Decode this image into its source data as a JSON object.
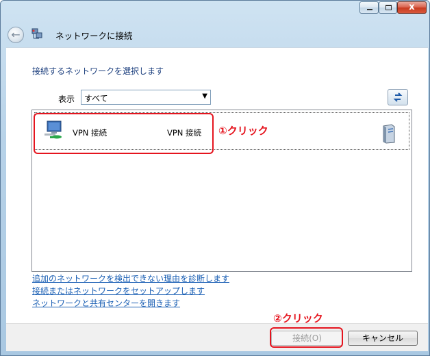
{
  "window": {
    "title": "ネットワークに接続",
    "close_glyph": "x"
  },
  "main": {
    "heading": "接続するネットワークを選択します",
    "show_label": "表示",
    "filter_selected": "すべて",
    "connections": [
      {
        "name": "VPN 接続",
        "type": "VPN 接続"
      }
    ]
  },
  "links": [
    "追加のネットワークを検出できない理由を診断します",
    "接続またはネットワークをセットアップします",
    "ネットワークと共有センターを開きます"
  ],
  "buttons": {
    "connect": "接続(O)",
    "cancel": "キャンセル"
  },
  "annotations": {
    "step1": "①クリック",
    "step2": "②クリック"
  },
  "colors": {
    "annotation": "#e5141e",
    "link": "#1a5fb4",
    "heading": "#1c3f7e"
  }
}
